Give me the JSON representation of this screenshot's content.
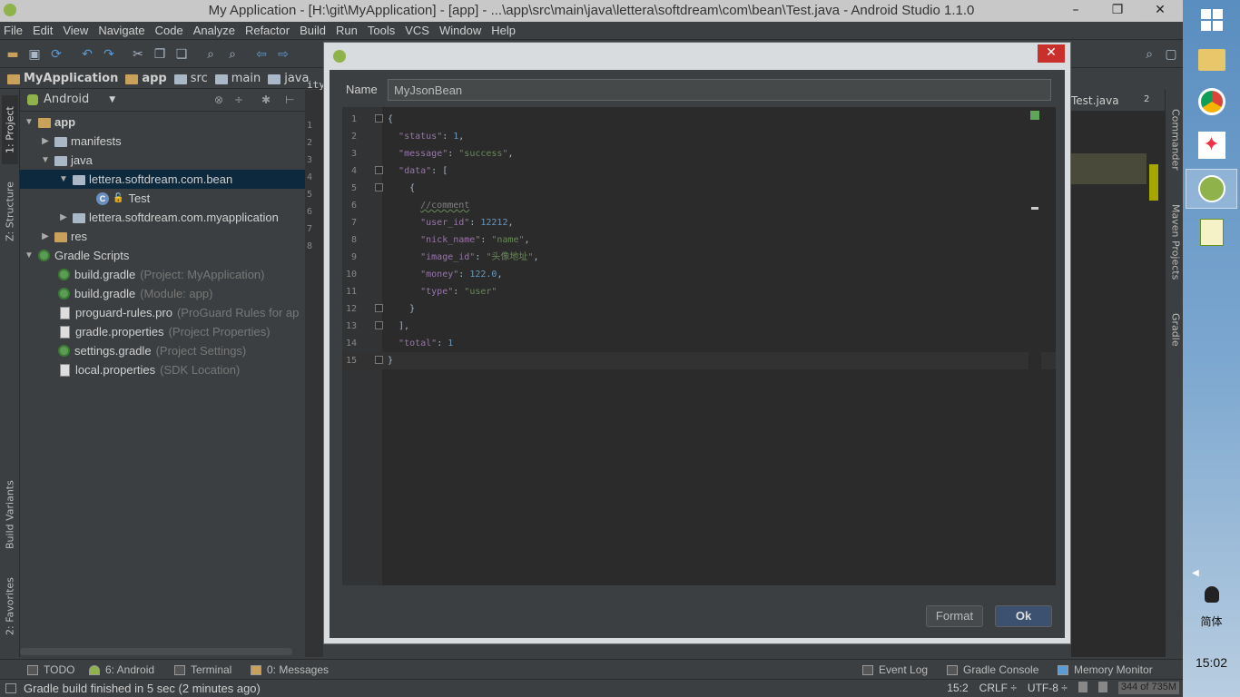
{
  "window": {
    "title": "My Application - [H:\\git\\MyApplication] - [app] - ...\\app\\src\\main\\java\\lettera\\softdream\\com\\bean\\Test.java - Android Studio 1.1.0",
    "minimize": "–",
    "maximize": "❐",
    "close": "✕"
  },
  "menu": [
    "File",
    "Edit",
    "View",
    "Navigate",
    "Code",
    "Analyze",
    "Refactor",
    "Build",
    "Run",
    "Tools",
    "VCS",
    "Window",
    "Help"
  ],
  "breadcrumb": [
    "MyApplication",
    "app",
    "src",
    "main",
    "java"
  ],
  "left_stripe": {
    "project": "1: Project",
    "structure": "Z: Structure",
    "build_variants": "Build Variants",
    "favorites": "2: Favorites"
  },
  "project_panel": {
    "view_selector": "Android",
    "tree": [
      {
        "label": "app",
        "hint": ""
      },
      {
        "label": "manifests",
        "hint": ""
      },
      {
        "label": "java",
        "hint": ""
      },
      {
        "label": "lettera.softdream.com.bean",
        "hint": ""
      },
      {
        "label": "Test",
        "hint": ""
      },
      {
        "label": "lettera.softdream.com.myapplication",
        "hint": ""
      },
      {
        "label": "res",
        "hint": ""
      },
      {
        "label": "Gradle Scripts",
        "hint": ""
      },
      {
        "label": "build.gradle",
        "hint": "(Project: MyApplication)"
      },
      {
        "label": "build.gradle",
        "hint": "(Module: app)"
      },
      {
        "label": "proguard-rules.pro",
        "hint": "(ProGuard Rules for ap"
      },
      {
        "label": "gradle.properties",
        "hint": "(Project Properties)"
      },
      {
        "label": "settings.gradle",
        "hint": "(Project Settings)"
      },
      {
        "label": "local.properties",
        "hint": "(SDK Location)"
      }
    ]
  },
  "editor_behind": {
    "tab_fragment": "ity_",
    "tab_right": "Test.java",
    "tab_count": "2",
    "line_numbers": [
      "1",
      "2",
      "3",
      "4",
      "5",
      "6",
      "7",
      "8"
    ]
  },
  "right_stripe": {
    "commander": "Commander",
    "maven": "Maven Projects",
    "gradle": "Gradle"
  },
  "dialog": {
    "name_label": "Name",
    "name_value": "MyJsonBean",
    "format_button": "Format",
    "ok_button": "Ok",
    "close": "✕",
    "code": [
      "{",
      "  \"status\": 1,",
      "  \"message\": \"success\",",
      "  \"data\": [",
      "    {",
      "      //comment",
      "      \"user_id\": 12212,",
      "      \"nick_name\": \"name\",",
      "      \"image_id\": \"头像地址\",",
      "      \"money\": 122.0,",
      "      \"type\": \"user\"",
      "    }",
      "  ],",
      "  \"total\": 1",
      "}"
    ]
  },
  "bottom_tools": {
    "todo": "TODO",
    "android": "6: Android",
    "terminal": "Terminal",
    "messages": "0: Messages",
    "event_log": "Event Log",
    "gradle_console": "Gradle Console",
    "memory_monitor": "Memory Monitor"
  },
  "status": {
    "message": "Gradle build finished in 5 sec (2 minutes ago)",
    "position": "15:2",
    "line_sep": "CRLF ÷",
    "encoding": "UTF-8 ÷",
    "memory": "344 of 735M"
  },
  "taskbar": {
    "ime": "简体",
    "clock": "15:02"
  },
  "colors": {
    "ide_bg": "#3c3f41",
    "editor_bg": "#2b2b2b",
    "selection": "#0d293e",
    "string": "#6a8759",
    "number": "#6897bb",
    "key": "#9876aa"
  }
}
